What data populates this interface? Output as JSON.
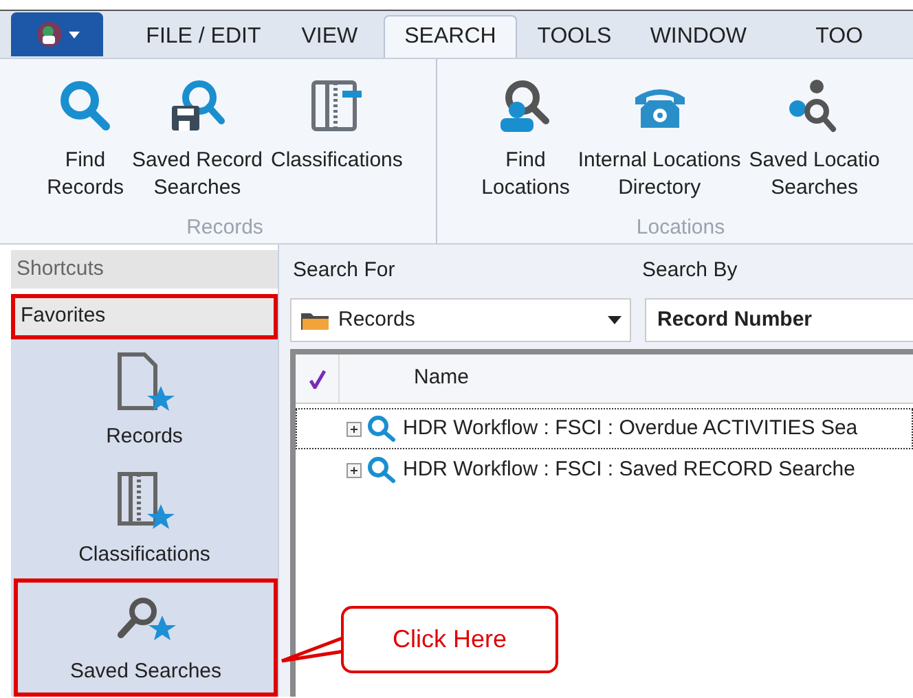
{
  "tabs": [
    {
      "label": "FILE / EDIT",
      "selected": false
    },
    {
      "label": "VIEW",
      "selected": false
    },
    {
      "label": "SEARCH",
      "selected": true
    },
    {
      "label": "TOOLS",
      "selected": false
    },
    {
      "label": "WINDOW",
      "selected": false
    },
    {
      "label": "TOO",
      "selected": false
    }
  ],
  "ribbon_groups": [
    {
      "label": "Records",
      "buttons": [
        {
          "lines": [
            "Find",
            "Records"
          ],
          "kind": "search"
        },
        {
          "lines": [
            "Saved Record",
            "Searches"
          ],
          "kind": "saved-search"
        },
        {
          "lines": [
            "Classifications"
          ],
          "kind": "binder"
        }
      ]
    },
    {
      "label": "Locations",
      "buttons": [
        {
          "lines": [
            "Find",
            "Locations"
          ],
          "kind": "person-search"
        },
        {
          "lines": [
            "Internal Locations",
            "Directory"
          ],
          "kind": "phone"
        },
        {
          "lines": [
            "Saved Locatio",
            "Searches"
          ],
          "kind": "people-search"
        }
      ]
    }
  ],
  "sidebar": {
    "header": "Shortcuts",
    "section": {
      "label": "Favorites",
      "annotated": true
    },
    "items": [
      {
        "label": "Records",
        "kind": "document",
        "annotated": false
      },
      {
        "label": "Classifications",
        "kind": "binder",
        "annotated": false
      },
      {
        "label": "Saved Searches",
        "kind": "search",
        "annotated": true
      }
    ]
  },
  "search_for": {
    "label": "Search For",
    "value": "Records"
  },
  "search_by": {
    "label": "Search By",
    "value": "Record Number"
  },
  "table": {
    "columns": [
      "Name"
    ],
    "rows": [
      {
        "name": "HDR Workflow : FSCI : Overdue ACTIVITIES Sea",
        "selected": true
      },
      {
        "name": "HDR Workflow : FSCI : Saved RECORD Searche",
        "selected": false
      }
    ]
  },
  "callout": {
    "text": "Click Here"
  }
}
